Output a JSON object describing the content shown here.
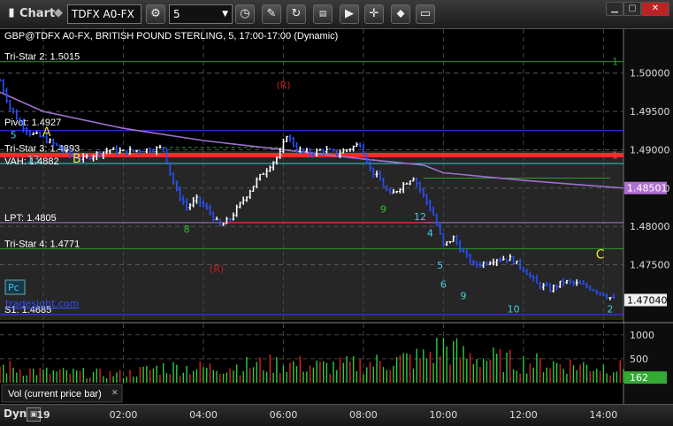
{
  "window": {
    "title": "Chart",
    "symbol": "TDFX A0-FX",
    "interval": "5",
    "header": "GBP@TDFX A0-FX, BRITISH POUND STERLING, 5, 17:00-17:00 (Dynamic)",
    "window_controls": [
      "minimize-icon",
      "maximize-icon",
      "close-icon"
    ]
  },
  "toolbar_icons": [
    "gear-icon",
    "clock-icon",
    "pencil-icon",
    "refresh-icon",
    "data-window-icon",
    "play-icon",
    "crosshair-icon",
    "comment-icon"
  ],
  "levels": [
    {
      "label": "Tri-Star 2: 1.5015",
      "value": 1.5015,
      "color": "#2aa02a"
    },
    {
      "label": "Pivot: 1.4927",
      "value": 1.4925,
      "color": "#3a3aff"
    },
    {
      "label": "Tri-Star 3: 1.4893",
      "value": 1.4893,
      "color": "#ff2a2a"
    },
    {
      "label": "VAH: 1.4882",
      "value": 1.4882,
      "color": "#2ad0d0"
    },
    {
      "label": "LPT: 1.4805",
      "value": 1.4805,
      "color": "#b070d0"
    },
    {
      "label": "Tri-Star 4: 1.4771",
      "value": 1.4771,
      "color": "#2aa02a"
    },
    {
      "label": "S1: 1.4685",
      "value": 1.4685,
      "color": "#3a3aff"
    }
  ],
  "level_tags": [
    {
      "text": "1",
      "value": 1.5015,
      "color": "#2aa02a"
    },
    {
      "text": "1",
      "value": 1.4893,
      "color": "#ff4040"
    }
  ],
  "annotations": [
    {
      "text": "A",
      "x": "00:05",
      "y": 1.4918,
      "color": "#e8e030"
    },
    {
      "text": "B",
      "x": "00:50",
      "y": 1.4883,
      "color": "#e8e030"
    },
    {
      "text": "C",
      "x": "13:55",
      "y": 1.4758,
      "color": "#e8e030"
    },
    {
      "text": "(R)",
      "x": "06:00",
      "y": 1.498,
      "color": "#c02020"
    },
    {
      "text": "(R)",
      "x": "04:20",
      "y": 1.474,
      "color": "#c02020"
    },
    {
      "text": "Pc",
      "color": "#40c0e0"
    },
    {
      "text": "tradesight.com",
      "color": "#3050ff"
    }
  ],
  "td_counts": [
    {
      "text": "5",
      "x": "23:15",
      "y": 1.4915,
      "color": "#40d0e0"
    },
    {
      "text": "13",
      "x": "23:45",
      "y": 1.4883,
      "color": "#40d0e0"
    },
    {
      "text": "8",
      "x": "03:35",
      "y": 1.4792,
      "color": "#30c030"
    },
    {
      "text": "9",
      "x": "08:30",
      "y": 1.4818,
      "color": "#30c030"
    },
    {
      "text": "12",
      "x": "09:25",
      "y": 1.4808,
      "color": "#40d0e0"
    },
    {
      "text": "4",
      "x": "09:40",
      "y": 1.4787,
      "color": "#40d0e0"
    },
    {
      "text": "5",
      "x": "09:55",
      "y": 1.4745,
      "color": "#40d0e0"
    },
    {
      "text": "6",
      "x": "10:00",
      "y": 1.472,
      "color": "#40d0e0"
    },
    {
      "text": "9",
      "x": "10:30",
      "y": 1.4705,
      "color": "#40d0e0"
    },
    {
      "text": "10",
      "x": "11:45",
      "y": 1.4688,
      "color": "#40d0e0"
    },
    {
      "text": "2",
      "x": "14:10",
      "y": 1.4688,
      "color": "#40d0e0"
    }
  ],
  "chart_data": {
    "type": "bar",
    "title": "GBP@TDFX A0-FX, BRITISH POUND STERLING, 5, 17:00-17:00 (Dynamic)",
    "x_tick_labels": [
      "19",
      "02:00",
      "04:00",
      "06:00",
      "08:00",
      "10:00",
      "12:00",
      "14:00"
    ],
    "x_tick_positions": [
      "00:00",
      "02:00",
      "04:00",
      "06:00",
      "08:00",
      "10:00",
      "12:00",
      "14:00"
    ],
    "x_range": [
      "22:55",
      "14:30"
    ],
    "price_axis": {
      "ticks": [
        1.5,
        1.495,
        1.49,
        1.485,
        1.48,
        1.475
      ],
      "tick_labels": [
        "1.50000",
        "1.49500",
        "1.49000",
        "1.48500",
        "1.48000",
        "1.47500"
      ],
      "ylim": [
        1.4678,
        1.5055
      ]
    },
    "price_tags": [
      {
        "label": "1.48501",
        "value": 1.48501,
        "color": "#b070d0",
        "text_color": "#ffffff"
      },
      {
        "label": "1.47040",
        "value": 1.4704,
        "color": "#f0f0f0",
        "text_color": "#000000"
      }
    ],
    "price_path": [
      [
        "22:55",
        1.499
      ],
      [
        "23:10",
        1.4955
      ],
      [
        "23:25",
        1.4935
      ],
      [
        "23:40",
        1.4922
      ],
      [
        "00:00",
        1.4915
      ],
      [
        "00:20",
        1.4905
      ],
      [
        "00:40",
        1.4893
      ],
      [
        "01:00",
        1.4888
      ],
      [
        "01:20",
        1.4895
      ],
      [
        "01:40",
        1.49
      ],
      [
        "02:00",
        1.4897
      ],
      [
        "02:30",
        1.49
      ],
      [
        "03:00",
        1.4902
      ],
      [
        "03:10",
        1.487
      ],
      [
        "03:20",
        1.4845
      ],
      [
        "03:35",
        1.4825
      ],
      [
        "03:50",
        1.4835
      ],
      [
        "04:10",
        1.4818
      ],
      [
        "04:25",
        1.48
      ],
      [
        "04:40",
        1.481
      ],
      [
        "05:00",
        1.4835
      ],
      [
        "05:20",
        1.486
      ],
      [
        "05:40",
        1.488
      ],
      [
        "05:55",
        1.4895
      ],
      [
        "06:05",
        1.492
      ],
      [
        "06:20",
        1.49
      ],
      [
        "06:40",
        1.4895
      ],
      [
        "07:00",
        1.49
      ],
      [
        "07:20",
        1.4895
      ],
      [
        "07:40",
        1.4902
      ],
      [
        "07:55",
        1.4908
      ],
      [
        "08:10",
        1.4875
      ],
      [
        "08:25",
        1.486
      ],
      [
        "08:40",
        1.484
      ],
      [
        "09:00",
        1.4855
      ],
      [
        "09:15",
        1.4865
      ],
      [
        "09:30",
        1.484
      ],
      [
        "09:45",
        1.4815
      ],
      [
        "10:00",
        1.4775
      ],
      [
        "10:15",
        1.4785
      ],
      [
        "10:30",
        1.4765
      ],
      [
        "10:45",
        1.475
      ],
      [
        "11:00",
        1.4752
      ],
      [
        "11:20",
        1.4758
      ],
      [
        "11:40",
        1.4758
      ],
      [
        "12:00",
        1.4745
      ],
      [
        "12:20",
        1.4725
      ],
      [
        "12:40",
        1.4718
      ],
      [
        "13:00",
        1.4728
      ],
      [
        "13:20",
        1.4725
      ],
      [
        "13:40",
        1.472
      ],
      [
        "14:00",
        1.4712
      ],
      [
        "14:15",
        1.4705
      ]
    ],
    "moving_average": {
      "color": "#a070d0",
      "values": [
        [
          "22:55",
          1.4975
        ],
        [
          "00:00",
          1.495
        ],
        [
          "02:00",
          1.4928
        ],
        [
          "04:00",
          1.4912
        ],
        [
          "06:00",
          1.49
        ],
        [
          "08:00",
          1.4888
        ],
        [
          "09:30",
          1.488
        ],
        [
          "10:00",
          1.487
        ],
        [
          "12:00",
          1.486
        ],
        [
          "14:30",
          1.485
        ]
      ]
    },
    "volume_panel": {
      "label": "Vol (current price bar)",
      "ticks": [
        1000,
        500
      ],
      "tick_labels": [
        "1000",
        "500"
      ],
      "ylim": [
        0,
        1180
      ],
      "current_value": 162,
      "current_label": "162",
      "colors": {
        "up": "#2ecc40",
        "down": "#e02020",
        "current_tag": "#33aa33"
      },
      "profile": [
        [
          "22:55",
          420
        ],
        [
          "00:00",
          280
        ],
        [
          "02:00",
          220
        ],
        [
          "03:00",
          400
        ],
        [
          "04:00",
          380
        ],
        [
          "06:00",
          500
        ],
        [
          "07:00",
          420
        ],
        [
          "08:00",
          480
        ],
        [
          "09:30",
          650
        ],
        [
          "10:00",
          950
        ],
        [
          "10:30",
          700
        ],
        [
          "12:00",
          520
        ],
        [
          "13:00",
          480
        ],
        [
          "14:30",
          380
        ]
      ]
    },
    "grid": true,
    "legend": "none"
  },
  "bottom_bar": {
    "mode_label": "Dyn"
  }
}
